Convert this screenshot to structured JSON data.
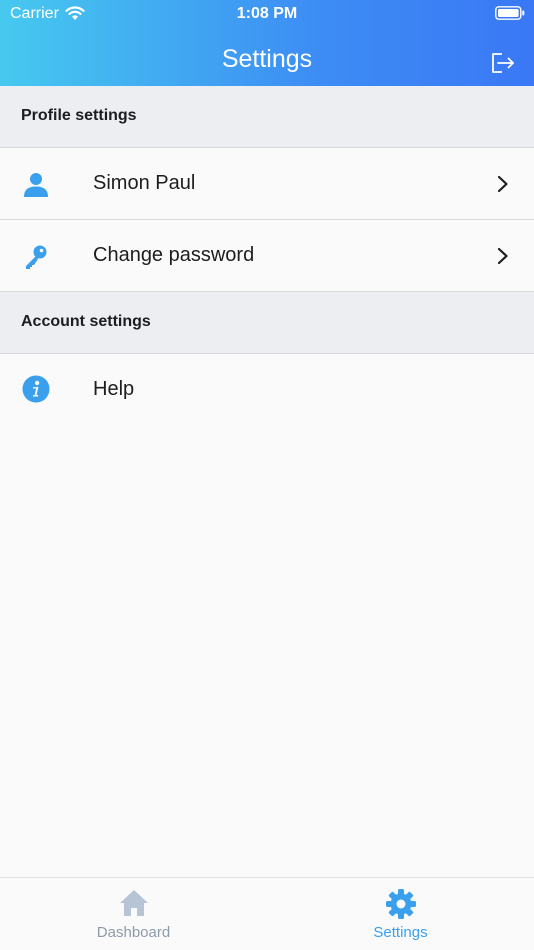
{
  "status_bar": {
    "carrier": "Carrier",
    "time": "1:08 PM"
  },
  "nav": {
    "title": "Settings",
    "logout_icon": "logout-icon"
  },
  "sections": {
    "profile": {
      "title": "Profile settings",
      "items": [
        {
          "label": "Simon Paul",
          "icon": "user-icon",
          "has_chevron": true
        },
        {
          "label": "Change password",
          "icon": "key-icon",
          "has_chevron": true
        }
      ]
    },
    "account": {
      "title": "Account settings",
      "items": [
        {
          "label": "Help",
          "icon": "info-icon",
          "has_chevron": false
        }
      ]
    }
  },
  "tab_bar": {
    "tabs": [
      {
        "label": "Dashboard",
        "icon": "home-icon",
        "active": false
      },
      {
        "label": "Settings",
        "icon": "gear-icon",
        "active": true
      }
    ]
  },
  "colors": {
    "accent": "#3aa0ee",
    "inactive_tab": "#8e9aaa",
    "header_gradient_start": "#46c9ef",
    "header_gradient_end": "#3a78f5"
  }
}
